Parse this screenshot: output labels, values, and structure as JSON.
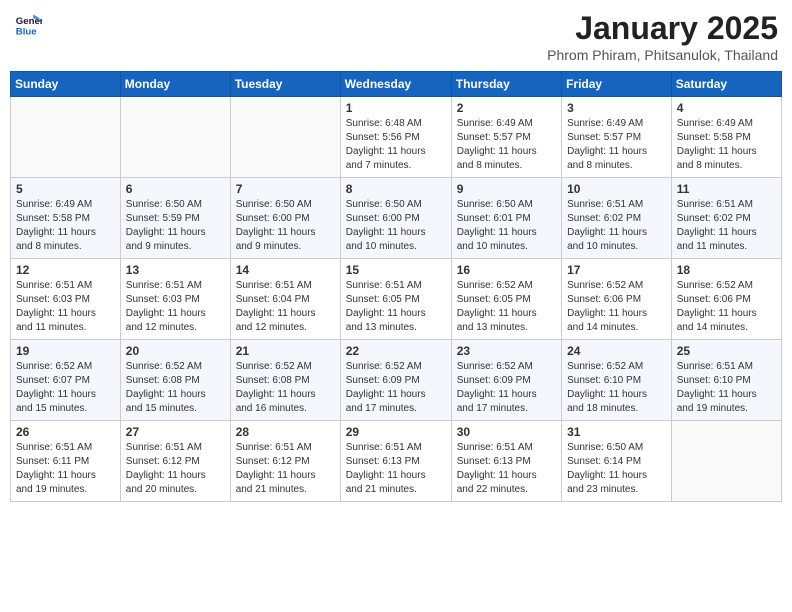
{
  "header": {
    "logo_line1": "General",
    "logo_line2": "Blue",
    "month": "January 2025",
    "location": "Phrom Phiram, Phitsanulok, Thailand"
  },
  "weekdays": [
    "Sunday",
    "Monday",
    "Tuesday",
    "Wednesday",
    "Thursday",
    "Friday",
    "Saturday"
  ],
  "weeks": [
    [
      {
        "day": "",
        "info": ""
      },
      {
        "day": "",
        "info": ""
      },
      {
        "day": "",
        "info": ""
      },
      {
        "day": "1",
        "info": "Sunrise: 6:48 AM\nSunset: 5:56 PM\nDaylight: 11 hours\nand 7 minutes."
      },
      {
        "day": "2",
        "info": "Sunrise: 6:49 AM\nSunset: 5:57 PM\nDaylight: 11 hours\nand 8 minutes."
      },
      {
        "day": "3",
        "info": "Sunrise: 6:49 AM\nSunset: 5:57 PM\nDaylight: 11 hours\nand 8 minutes."
      },
      {
        "day": "4",
        "info": "Sunrise: 6:49 AM\nSunset: 5:58 PM\nDaylight: 11 hours\nand 8 minutes."
      }
    ],
    [
      {
        "day": "5",
        "info": "Sunrise: 6:49 AM\nSunset: 5:58 PM\nDaylight: 11 hours\nand 8 minutes."
      },
      {
        "day": "6",
        "info": "Sunrise: 6:50 AM\nSunset: 5:59 PM\nDaylight: 11 hours\nand 9 minutes."
      },
      {
        "day": "7",
        "info": "Sunrise: 6:50 AM\nSunset: 6:00 PM\nDaylight: 11 hours\nand 9 minutes."
      },
      {
        "day": "8",
        "info": "Sunrise: 6:50 AM\nSunset: 6:00 PM\nDaylight: 11 hours\nand 10 minutes."
      },
      {
        "day": "9",
        "info": "Sunrise: 6:50 AM\nSunset: 6:01 PM\nDaylight: 11 hours\nand 10 minutes."
      },
      {
        "day": "10",
        "info": "Sunrise: 6:51 AM\nSunset: 6:02 PM\nDaylight: 11 hours\nand 10 minutes."
      },
      {
        "day": "11",
        "info": "Sunrise: 6:51 AM\nSunset: 6:02 PM\nDaylight: 11 hours\nand 11 minutes."
      }
    ],
    [
      {
        "day": "12",
        "info": "Sunrise: 6:51 AM\nSunset: 6:03 PM\nDaylight: 11 hours\nand 11 minutes."
      },
      {
        "day": "13",
        "info": "Sunrise: 6:51 AM\nSunset: 6:03 PM\nDaylight: 11 hours\nand 12 minutes."
      },
      {
        "day": "14",
        "info": "Sunrise: 6:51 AM\nSunset: 6:04 PM\nDaylight: 11 hours\nand 12 minutes."
      },
      {
        "day": "15",
        "info": "Sunrise: 6:51 AM\nSunset: 6:05 PM\nDaylight: 11 hours\nand 13 minutes."
      },
      {
        "day": "16",
        "info": "Sunrise: 6:52 AM\nSunset: 6:05 PM\nDaylight: 11 hours\nand 13 minutes."
      },
      {
        "day": "17",
        "info": "Sunrise: 6:52 AM\nSunset: 6:06 PM\nDaylight: 11 hours\nand 14 minutes."
      },
      {
        "day": "18",
        "info": "Sunrise: 6:52 AM\nSunset: 6:06 PM\nDaylight: 11 hours\nand 14 minutes."
      }
    ],
    [
      {
        "day": "19",
        "info": "Sunrise: 6:52 AM\nSunset: 6:07 PM\nDaylight: 11 hours\nand 15 minutes."
      },
      {
        "day": "20",
        "info": "Sunrise: 6:52 AM\nSunset: 6:08 PM\nDaylight: 11 hours\nand 15 minutes."
      },
      {
        "day": "21",
        "info": "Sunrise: 6:52 AM\nSunset: 6:08 PM\nDaylight: 11 hours\nand 16 minutes."
      },
      {
        "day": "22",
        "info": "Sunrise: 6:52 AM\nSunset: 6:09 PM\nDaylight: 11 hours\nand 17 minutes."
      },
      {
        "day": "23",
        "info": "Sunrise: 6:52 AM\nSunset: 6:09 PM\nDaylight: 11 hours\nand 17 minutes."
      },
      {
        "day": "24",
        "info": "Sunrise: 6:52 AM\nSunset: 6:10 PM\nDaylight: 11 hours\nand 18 minutes."
      },
      {
        "day": "25",
        "info": "Sunrise: 6:51 AM\nSunset: 6:10 PM\nDaylight: 11 hours\nand 19 minutes."
      }
    ],
    [
      {
        "day": "26",
        "info": "Sunrise: 6:51 AM\nSunset: 6:11 PM\nDaylight: 11 hours\nand 19 minutes."
      },
      {
        "day": "27",
        "info": "Sunrise: 6:51 AM\nSunset: 6:12 PM\nDaylight: 11 hours\nand 20 minutes."
      },
      {
        "day": "28",
        "info": "Sunrise: 6:51 AM\nSunset: 6:12 PM\nDaylight: 11 hours\nand 21 minutes."
      },
      {
        "day": "29",
        "info": "Sunrise: 6:51 AM\nSunset: 6:13 PM\nDaylight: 11 hours\nand 21 minutes."
      },
      {
        "day": "30",
        "info": "Sunrise: 6:51 AM\nSunset: 6:13 PM\nDaylight: 11 hours\nand 22 minutes."
      },
      {
        "day": "31",
        "info": "Sunrise: 6:50 AM\nSunset: 6:14 PM\nDaylight: 11 hours\nand 23 minutes."
      },
      {
        "day": "",
        "info": ""
      }
    ]
  ]
}
